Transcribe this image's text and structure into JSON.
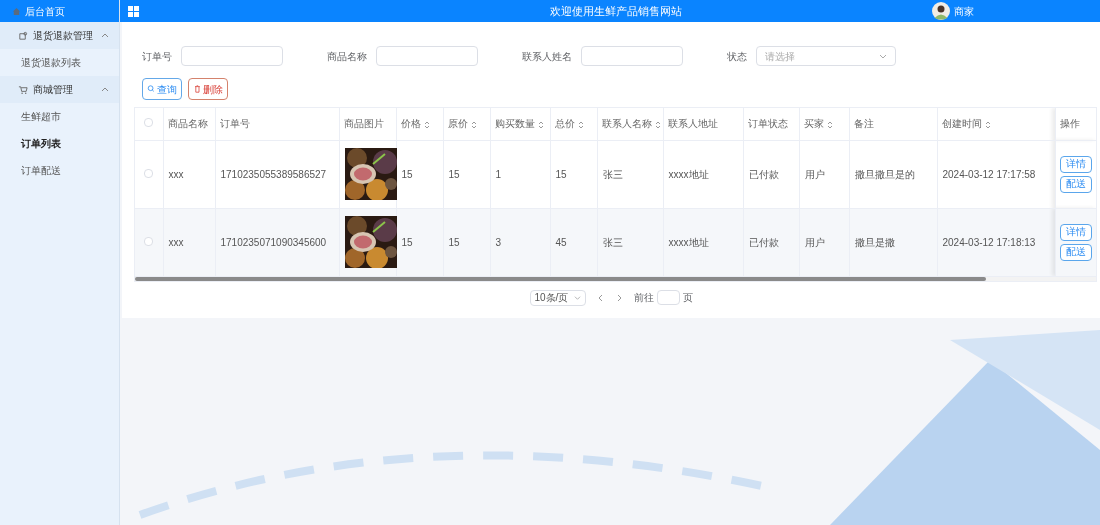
{
  "header": {
    "home": "后台首页",
    "title": "欢迎使用生鲜产品销售网站",
    "user": "商家"
  },
  "sidebar": {
    "groups": [
      {
        "label": "退货退款管理",
        "expanded": true,
        "children": [
          {
            "label": "退货退款列表",
            "selected": false
          }
        ]
      },
      {
        "label": "商城管理",
        "expanded": true,
        "children": [
          {
            "label": "生鲜超市",
            "selected": false
          },
          {
            "label": "订单列表",
            "selected": true
          },
          {
            "label": "订单配送",
            "selected": false
          }
        ]
      }
    ]
  },
  "filters": [
    {
      "label": "订单号",
      "kind": "input"
    },
    {
      "label": "商品名称",
      "kind": "input"
    },
    {
      "label": "联系人姓名",
      "kind": "input"
    },
    {
      "label": "状态",
      "kind": "select",
      "placeholder": "请选择"
    }
  ],
  "actions": [
    {
      "label": "查询",
      "kind": "search"
    },
    {
      "label": "删除",
      "kind": "delete"
    }
  ],
  "table": {
    "select_all_checked": false,
    "columns": [
      {
        "label": "商品名称",
        "sortable": false
      },
      {
        "label": "订单号",
        "sortable": false
      },
      {
        "label": "商品图片",
        "sortable": false
      },
      {
        "label": "价格",
        "sortable": true
      },
      {
        "label": "原价",
        "sortable": true
      },
      {
        "label": "购买数量",
        "sortable": true
      },
      {
        "label": "总价",
        "sortable": true
      },
      {
        "label": "联系人名称",
        "sortable": true
      },
      {
        "label": "联系人地址",
        "sortable": false
      },
      {
        "label": "订单状态",
        "sortable": false
      },
      {
        "label": "买家",
        "sortable": true
      },
      {
        "label": "备注",
        "sortable": false
      },
      {
        "label": "创建时间",
        "sortable": true
      },
      {
        "label": "操作",
        "sortable": false
      }
    ],
    "rows": [
      {
        "checked": false,
        "cells": [
          "xxx",
          "1710235055389586527",
          {
            "kind": "picture"
          },
          "15",
          "15",
          "1",
          "15",
          "张三",
          "xxxx地址",
          "已付款",
          "用户",
          "撒旦撒旦是的",
          "2024-03-12 17:17:58"
        ],
        "buttons": [
          "详情",
          "配送"
        ]
      },
      {
        "checked": false,
        "cells": [
          "xxx",
          "1710235071090345600",
          {
            "kind": "picture"
          },
          "15",
          "15",
          "3",
          "45",
          "张三",
          "xxxx地址",
          "已付款",
          "用户",
          "撒旦是撒",
          "2024-03-12 17:18:13"
        ],
        "buttons": [
          "详情",
          "配送"
        ]
      }
    ]
  },
  "pagination": {
    "page_size": "10条/页",
    "goto": "前往",
    "page_suffix": "页"
  }
}
